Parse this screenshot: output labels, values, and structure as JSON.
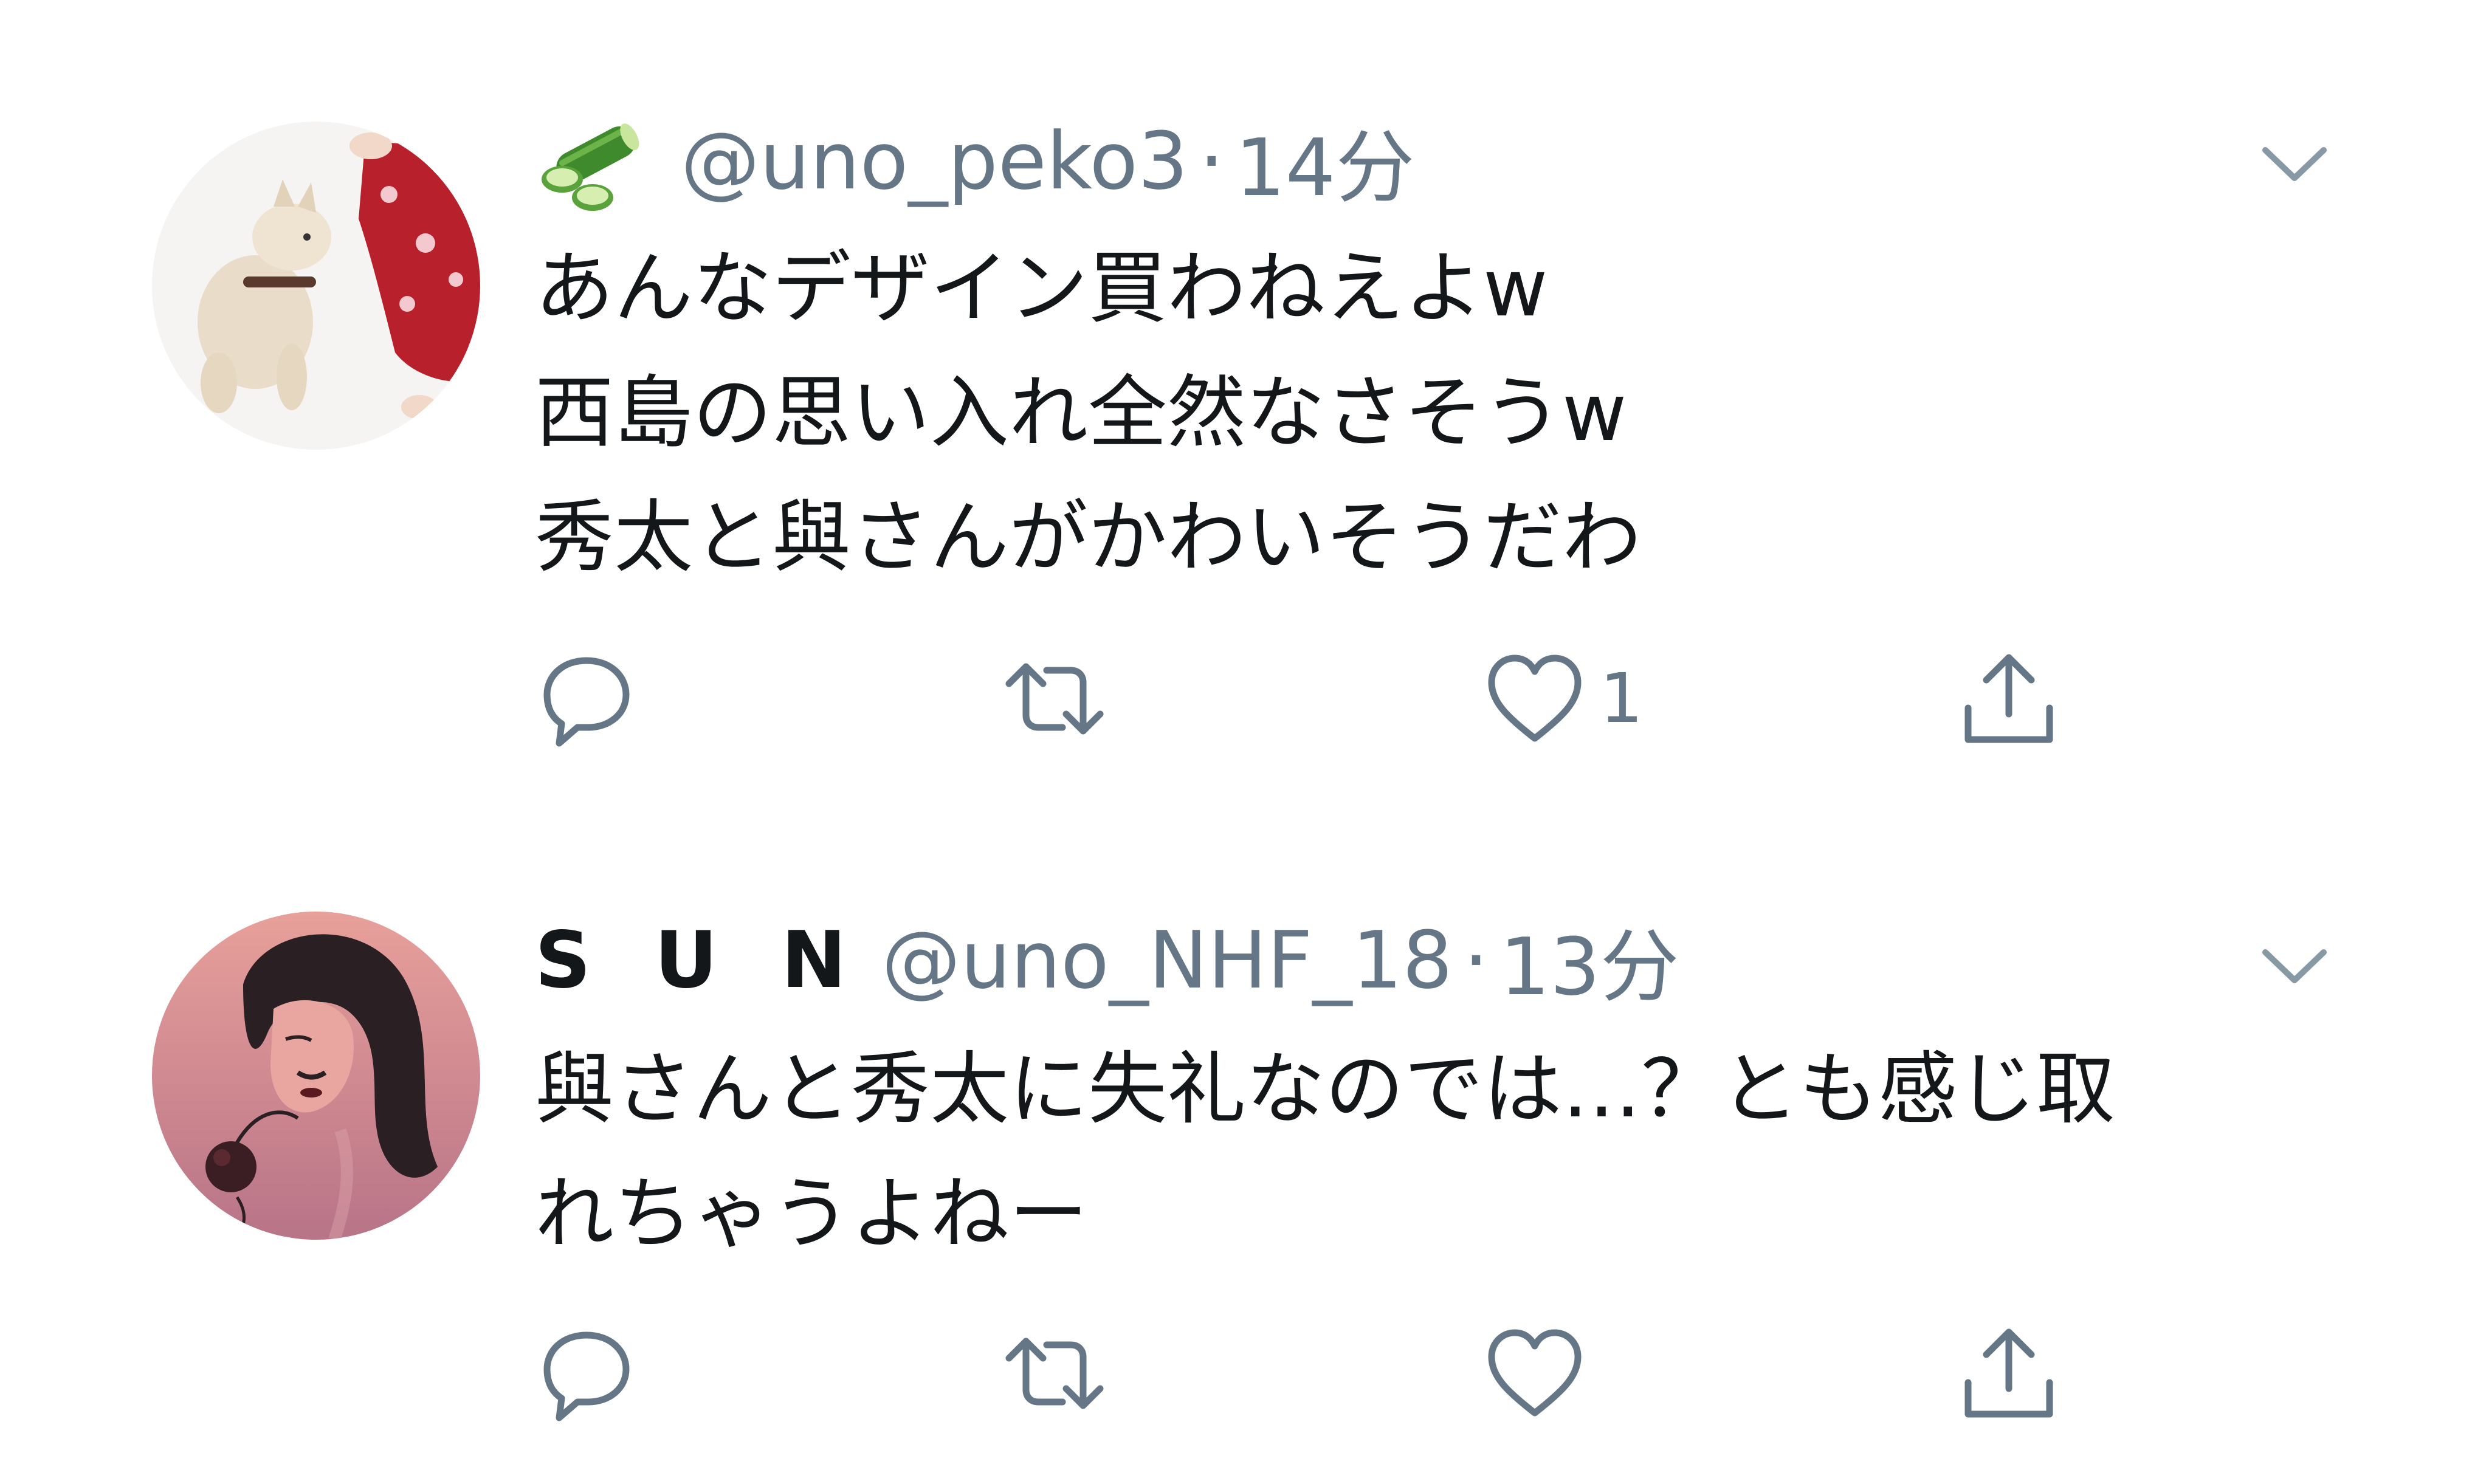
{
  "colors": {
    "text_primary": "#14171a",
    "text_secondary": "#657786",
    "icon": "#657786",
    "background": "#ffffff"
  },
  "tweets": [
    {
      "display_name": "",
      "display_name_icon": "cucumber-emoji",
      "handle": "@uno_peko3",
      "separator": "·",
      "time": "14分",
      "body": "あんなデザイン買わねえよw\n西島の思い入れ全然なさそうw\n秀太と與さんがかわいそうだわ",
      "actions": {
        "reply_icon": "reply-icon",
        "retweet_icon": "retweet-icon",
        "like_icon": "heart-icon",
        "like_count": "1",
        "share_icon": "share-icon"
      }
    },
    {
      "display_name": "S U N",
      "handle": "@uno_NHF_18",
      "separator": "·",
      "time": "13分",
      "body": "與さんと秀太に失礼なのでは…？とも感じ取\nれちゃうよねー",
      "actions": {
        "reply_icon": "reply-icon",
        "retweet_icon": "retweet-icon",
        "like_icon": "heart-icon",
        "like_count": "",
        "share_icon": "share-icon"
      }
    }
  ]
}
